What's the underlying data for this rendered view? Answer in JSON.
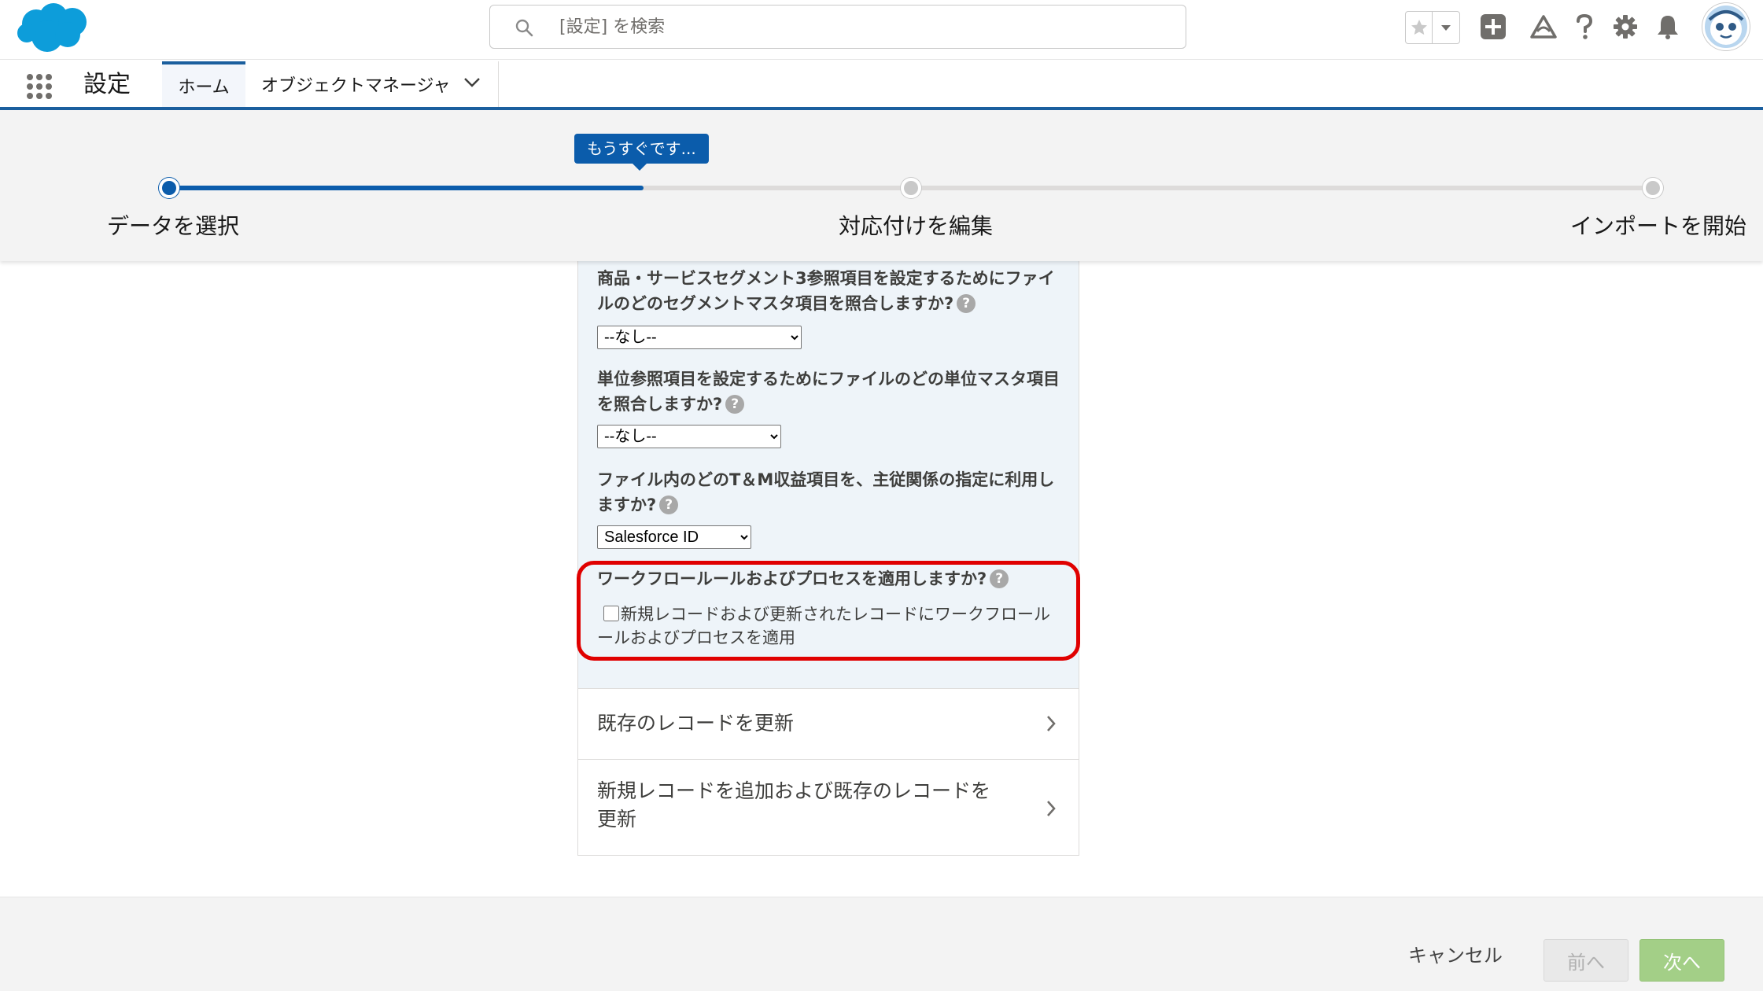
{
  "header": {
    "search_placeholder": "[設定] を検索",
    "icons": [
      "cloud-logo",
      "search-icon",
      "star-icon",
      "chevron-down-icon",
      "plus-icon",
      "trailhead-icon",
      "help-icon",
      "gear-icon",
      "bell-icon",
      "avatar"
    ]
  },
  "context_bar": {
    "app_name": "設定",
    "tabs": [
      {
        "label": "ホーム",
        "active": true
      },
      {
        "label": "オブジェクトマネージャ",
        "active": false
      }
    ]
  },
  "wizard": {
    "tooltip": "もうすぐです...",
    "progress": 0.32,
    "steps": [
      {
        "label": "データを選択",
        "status": "complete"
      },
      {
        "label": "対応付けを編集",
        "status": "incomplete"
      },
      {
        "label": "インポートを開始",
        "status": "incomplete"
      }
    ]
  },
  "form": {
    "q1": {
      "label": "商品・サービスセグメント3参照項目を設定するためにファイルのどのセグメントマスタ項目を照合しますか?",
      "value": "--なし--"
    },
    "q2": {
      "label": "単位参照項目を設定するためにファイルのどの単位マスタ項目を照合しますか?",
      "value": "--なし--"
    },
    "q3": {
      "label": "ファイル内のどのT＆M収益項目を、主従関係の指定に利用しますか?",
      "value": "Salesforce ID"
    },
    "q4": {
      "label": "ワークフロールールおよびプロセスを適用しますか?",
      "checkbox_label": "新規レコードおよび更新されたレコードにワークフロールールおよびプロセスを適用",
      "checked": false
    },
    "help_glyph": "?"
  },
  "options": [
    {
      "label": "既存のレコードを更新"
    },
    {
      "label": "新規レコードを追加および既存のレコードを更新"
    }
  ],
  "footer": {
    "cancel": "キャンセル",
    "prev": "前へ",
    "next": "次へ"
  },
  "colors": {
    "brand_blue": "#0b5cab",
    "highlight_red": "#e00000",
    "next_green": "#a3cf87",
    "form_bg": "#eef4f9"
  }
}
